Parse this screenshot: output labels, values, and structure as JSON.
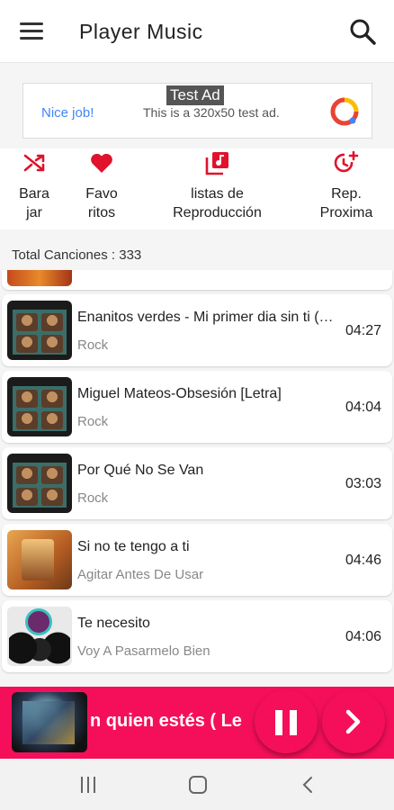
{
  "app_bar": {
    "title": "Player Music",
    "menu_icon": "hamburger-menu-icon",
    "search_icon": "search-icon"
  },
  "ad": {
    "badge": "Test Ad",
    "headline": "Nice job!",
    "body": "This is a 320x50 test ad.",
    "logo_icon": "admob-logo-icon"
  },
  "actions": [
    {
      "label": "Bara\njar",
      "icon": "shuffle-icon"
    },
    {
      "label": "Favo\nritos",
      "icon": "heart-icon"
    },
    {
      "label": "listas de\nReproducción",
      "icon": "playlist-icon"
    },
    {
      "label": "Rep.\nProxima",
      "icon": "timer-add-icon"
    }
  ],
  "total_label": "Total Canciones : 333",
  "songs": [
    {
      "title": "Enanitos verdes - Mi primer dia sin ti (C...",
      "artist": "Rock",
      "duration": "04:27",
      "cover": "hombres-g-cover"
    },
    {
      "title": "Miguel Mateos-Obsesión [Letra]",
      "artist": "Rock",
      "duration": "04:04",
      "cover": "hombres-g-cover"
    },
    {
      "title": "Por Qué No Se Van",
      "artist": "Rock",
      "duration": "03:03",
      "cover": "hombres-g-cover"
    },
    {
      "title": "Si no te tengo a ti",
      "artist": "Agitar Antes De Usar",
      "duration": "04:46",
      "cover": "agitar-cover"
    },
    {
      "title": "Te necesito",
      "artist": "Voy A Pasarmelo Bien",
      "duration": "04:06",
      "cover": "pasarmelo-bien-cover"
    }
  ],
  "now_playing": {
    "title": "n quien estés ( Le",
    "pause_icon": "pause-icon",
    "next_icon": "next-icon"
  },
  "navbar": {
    "recents_icon": "recents-icon",
    "home_icon": "home-icon",
    "back_icon": "back-icon"
  },
  "colors": {
    "accent": "#e0122c",
    "now_playing_bg": "#f50f5a",
    "ad_link": "#4285f4"
  }
}
